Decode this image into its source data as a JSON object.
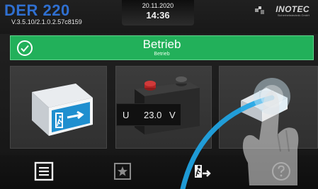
{
  "header": {
    "device_name": "DER 220",
    "version": "V.3.5.10/2.1.0.2.57c8159",
    "date": "20.11.2020",
    "time": "14:36",
    "brand_name": "INOTEC",
    "brand_sub": "Sicherheitstechnik GmbH"
  },
  "status": {
    "title": "Betrieb",
    "subtitle": "Betrieb",
    "color": "#22b05a"
  },
  "tiles": {
    "exit_sign_icon": "exit-sign-icon",
    "battery_icon": "battery-icon",
    "module_icon": "module-icon"
  },
  "battery": {
    "label": "U",
    "value": "23.0",
    "unit": "V"
  },
  "nav": {
    "menu_icon": "menu-list-icon",
    "favorites_icon": "star-icon",
    "sign_icon": "emergency-sign-icon",
    "help_icon": "help-icon"
  },
  "colors": {
    "accent_blue": "#2f6fd0",
    "status_green": "#22b05a",
    "swipe_cyan": "#1fa6e6"
  }
}
